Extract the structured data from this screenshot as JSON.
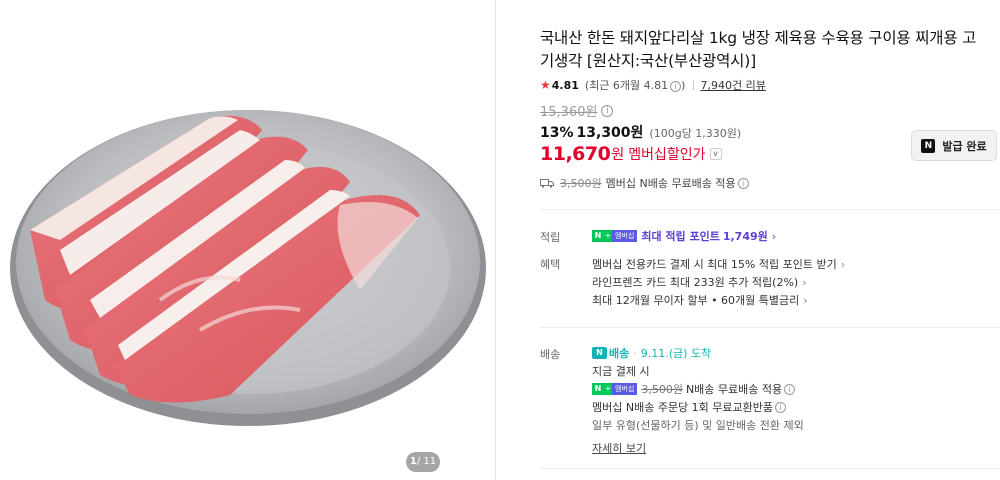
{
  "gallery": {
    "image_alt": "",
    "pager_current": "1",
    "pager_total": "/ 11"
  },
  "product": {
    "title": "국내산 한돈 돼지앞다리살 1kg 냉장 제육용 수육용 구이용 찌개용 고기생각 [원산지:국산(부산광역시)]",
    "rating_star": "★",
    "rating": "4.81",
    "rating_recent": "(최근 6개월 4.81",
    "rating_recent_close": ")",
    "review_count": "7,940건 리뷰",
    "original_price": "15,360원",
    "discount_pct": "13%",
    "discount_price": "13,300원",
    "unit_price": "(100g당 1,330원)",
    "member_price": "11,670",
    "member_won": "원",
    "member_label": "멤버십할인가",
    "coupon_button": "발급 완료",
    "coupon_logo": "N",
    "shipping_orig": "3,500원",
    "shipping_text": "멤버십 N배송 무료배송 적용"
  },
  "benefits": {
    "points_label": "적립",
    "points_link": "최대 적립 포인트",
    "points_value": "1,749원",
    "perks_label": "혜택",
    "perk1": "멤버십 전용카드 결제 시 최대 15% 적립 포인트 받기",
    "perk2": "라인프렌즈 카드 최대 233원 추가 적립(2%)",
    "perk3": "최대 12개월 무이자 할부 • 60개월 특별금리"
  },
  "delivery": {
    "label": "배송",
    "n_delivery": "배송",
    "arrive": "9.11.(금) 도착",
    "pay_now": "지금 결제 시",
    "ship_orig": "3,500원",
    "ship_free": "N배송 무료배송 적용",
    "exchange": "멤버십 N배송 주문당 1회 무료교환반품",
    "note": "일부 유형(선물하기 등) 및 일반배송 전환 제외",
    "detail_link": "자세히 보기"
  },
  "badges": {
    "n": "N",
    "plus": "+",
    "membership": "멤버십"
  },
  "icons": {
    "info": "i",
    "chevron": "›",
    "chevron_down": "v"
  },
  "colors": {
    "member_red": "#e3002a",
    "naver_green": "#03c75a",
    "point_purple": "#5a3ed6",
    "delivery_teal": "#13b3b5"
  }
}
